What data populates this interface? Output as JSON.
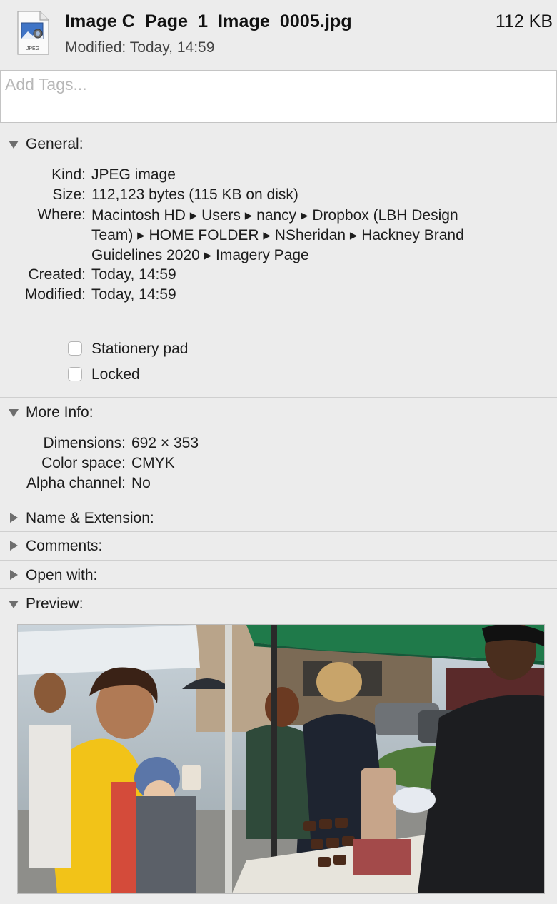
{
  "file": {
    "icon_name": "jpeg-file-icon",
    "icon_label": "JPEG",
    "name": "Image C_Page_1_Image_0005.jpg",
    "size": "112 KB",
    "modified_label": "Modified:",
    "modified_value": "Today, 14:59"
  },
  "tags": {
    "placeholder": "Add Tags..."
  },
  "general": {
    "title": "General:",
    "kind_label": "Kind:",
    "kind_value": "JPEG image",
    "size_label": "Size:",
    "size_value": "112,123 bytes (115 KB on disk)",
    "where_label": "Where:",
    "where_lines": [
      "Macintosh HD ▸ Users ▸ nancy ▸ Dropbox (LBH Design",
      "Team) ▸ HOME FOLDER ▸ NSheridan ▸ Hackney Brand",
      "Guidelines 2020 ▸ Imagery Page"
    ],
    "created_label": "Created:",
    "created_value": "Today, 14:59",
    "modified_label": "Modified:",
    "modified_value": "Today, 14:59",
    "stationery_label": "Stationery pad",
    "stationery_checked": false,
    "locked_label": "Locked",
    "locked_checked": false
  },
  "more_info": {
    "title": "More Info:",
    "dimensions_label": "Dimensions:",
    "dimensions_value": "692 × 353",
    "color_space_label": "Color space:",
    "color_space_value": "CMYK",
    "alpha_label": "Alpha channel:",
    "alpha_value": "No"
  },
  "name_extension": {
    "title": "Name & Extension:",
    "expanded": false
  },
  "comments": {
    "title": "Comments:",
    "expanded": false
  },
  "open_with": {
    "title": "Open with:",
    "expanded": false
  },
  "preview": {
    "title": "Preview:",
    "expanded": true,
    "image_description": "photo-market-scene"
  },
  "colors": {
    "panel_bg": "#ececec",
    "separator": "#cfcfcf",
    "triangle": "#6e6e6e"
  }
}
